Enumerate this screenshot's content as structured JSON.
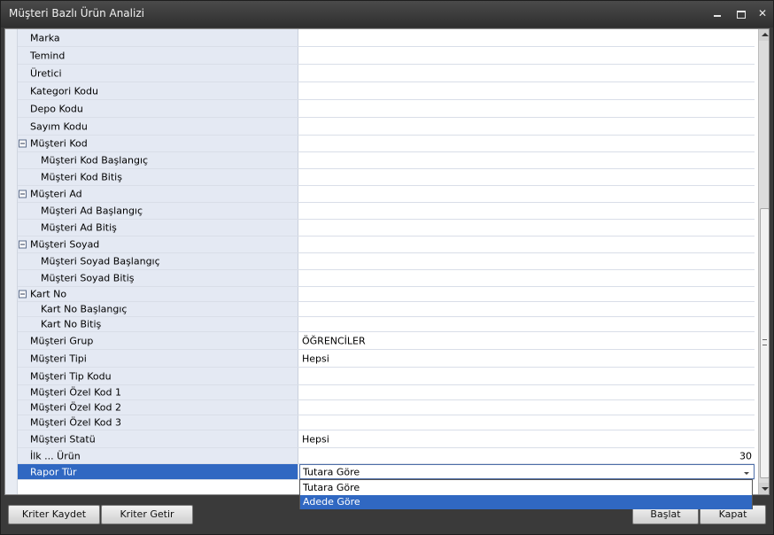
{
  "window": {
    "title": "Müşteri Bazlı Ürün Analizi"
  },
  "rows": [
    {
      "label": "Marka",
      "value": ""
    },
    {
      "label": "Temind",
      "value": ""
    },
    {
      "label": "Üretici",
      "value": ""
    },
    {
      "label": "Kategori Kodu",
      "value": ""
    },
    {
      "label": "Depo Kodu",
      "value": ""
    },
    {
      "label": "Sayım Kodu",
      "value": ""
    },
    {
      "label": "Müşteri Kod",
      "value": ""
    },
    {
      "label": "Müşteri Kod Başlangıç",
      "value": ""
    },
    {
      "label": "Müşteri Kod Bitiş",
      "value": ""
    },
    {
      "label": "Müşteri Ad",
      "value": ""
    },
    {
      "label": "Müşteri Ad Başlangıç",
      "value": ""
    },
    {
      "label": "Müşteri Ad Bitiş",
      "value": ""
    },
    {
      "label": "Müşteri Soyad",
      "value": ""
    },
    {
      "label": "Müşteri Soyad Başlangıç",
      "value": ""
    },
    {
      "label": "Müşteri Soyad Bitiş",
      "value": ""
    },
    {
      "label": "Kart No",
      "value": ""
    },
    {
      "label": "Kart No Başlangıç",
      "value": ""
    },
    {
      "label": "Kart No Bitiş",
      "value": ""
    },
    {
      "label": "Müşteri Grup",
      "value": "ÖĞRENCİLER"
    },
    {
      "label": "Müşteri Tipi",
      "value": "Hepsi"
    },
    {
      "label": "Müşteri Tip Kodu",
      "value": ""
    },
    {
      "label": "Müşteri Özel Kod 1",
      "value": ""
    },
    {
      "label": "Müşteri Özel Kod 2",
      "value": ""
    },
    {
      "label": "Müşteri Özel Kod 3",
      "value": ""
    },
    {
      "label": "Müşteri Statü",
      "value": "Hepsi"
    },
    {
      "label": "İlk ... Ürün",
      "value": "30"
    },
    {
      "label": "Rapor Tür",
      "value": "Tutara Göre"
    }
  ],
  "dropdown": {
    "options": [
      "Tutara Göre",
      "Adede Göre"
    ],
    "highlighted": "Adede Göre"
  },
  "buttons": {
    "save_criteria": "Kriter Kaydet",
    "load_criteria": "Kriter Getir",
    "start": "Başlat",
    "close": "Kapat"
  },
  "colors": {
    "selection": "#3068c2",
    "label_column": "#e4e9f3"
  }
}
